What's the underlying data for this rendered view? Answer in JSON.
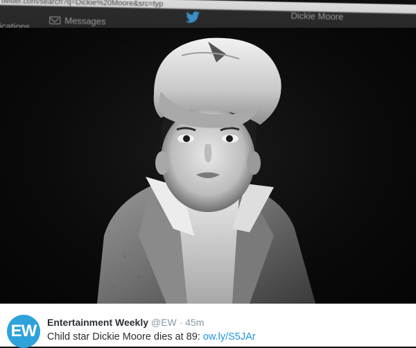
{
  "browser": {
    "url": "twitter.com/search?q=Dickie%20Moore&src=typ"
  },
  "nav": {
    "notifications_label": "tifications",
    "messages_label": "Messages",
    "user_label": "Dickie Moore",
    "icons": [
      "envelope-icon",
      "twitter-bird-icon"
    ]
  },
  "tweet": {
    "avatar_text": "EW",
    "name": "Entertainment Weekly",
    "handle": "@EW",
    "separator": "·",
    "time": "45m",
    "text": "Child star Dickie Moore dies at 89:",
    "link": "ow.ly/S5JAr",
    "colors": {
      "avatar_bg": "#2fa3d9",
      "link": "#1b95e0"
    }
  }
}
